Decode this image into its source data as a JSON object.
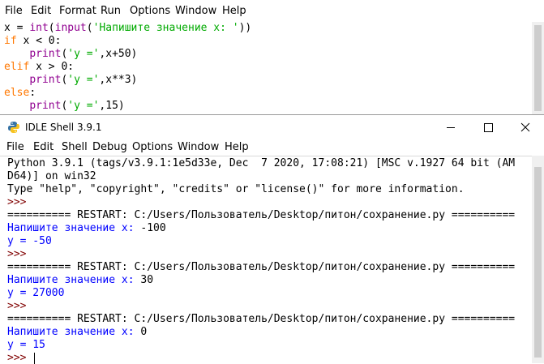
{
  "editor_menu": [
    "File",
    "Edit",
    "Format",
    "Run",
    "Options",
    "Window",
    "Help"
  ],
  "editor_lines": [
    [
      {
        "t": "x = "
      },
      {
        "t": "int",
        "c": "bi"
      },
      {
        "t": "("
      },
      {
        "t": "input",
        "c": "bi"
      },
      {
        "t": "("
      },
      {
        "t": "'Напишите значение x: '",
        "c": "str"
      },
      {
        "t": "))"
      }
    ],
    [
      {
        "t": "if",
        "c": "kw"
      },
      {
        "t": " x < 0:"
      }
    ],
    [
      {
        "t": "    "
      },
      {
        "t": "print",
        "c": "bi"
      },
      {
        "t": "("
      },
      {
        "t": "'y ='",
        "c": "str"
      },
      {
        "t": ",x+50)"
      }
    ],
    [
      {
        "t": "elif",
        "c": "kw"
      },
      {
        "t": " x > 0:"
      }
    ],
    [
      {
        "t": "    "
      },
      {
        "t": "print",
        "c": "bi"
      },
      {
        "t": "("
      },
      {
        "t": "'y ='",
        "c": "str"
      },
      {
        "t": ",x**3)"
      }
    ],
    [
      {
        "t": "else",
        "c": "kw"
      },
      {
        "t": ":"
      }
    ],
    [
      {
        "t": "    "
      },
      {
        "t": "print",
        "c": "bi"
      },
      {
        "t": "("
      },
      {
        "t": "'y ='",
        "c": "str"
      },
      {
        "t": ",15)"
      }
    ]
  ],
  "shell_window": {
    "title": "IDLE Shell 3.9.1"
  },
  "shell_menu": [
    "File",
    "Edit",
    "Shell",
    "Debug",
    "Options",
    "Window",
    "Help"
  ],
  "shell_lines": [
    [
      {
        "t": "Python 3.9.1 (tags/v3.9.1:1e5d33e, Dec  7 2020, 17:08:21) [MSC v.1927 64 bit (AM"
      }
    ],
    [
      {
        "t": "D64)] on win32"
      }
    ],
    [
      {
        "t": "Type \"help\", \"copyright\", \"credits\" or \"license()\" for more information."
      }
    ],
    [
      {
        "t": ">>> ",
        "c": "prompt"
      }
    ],
    [
      {
        "t": "========== RESTART: C:/Users/Пользователь/Desktop/питон/сохранение.py =========="
      }
    ],
    [
      {
        "t": "Напишите значение x: ",
        "c": "blue"
      },
      {
        "t": "-100"
      }
    ],
    [
      {
        "t": "y = -50",
        "c": "blue"
      }
    ],
    [
      {
        "t": ">>> ",
        "c": "prompt"
      }
    ],
    [
      {
        "t": "========== RESTART: C:/Users/Пользователь/Desktop/питон/сохранение.py =========="
      }
    ],
    [
      {
        "t": "Напишите значение x: ",
        "c": "blue"
      },
      {
        "t": "30"
      }
    ],
    [
      {
        "t": "y = 27000",
        "c": "blue"
      }
    ],
    [
      {
        "t": ">>> ",
        "c": "prompt"
      }
    ],
    [
      {
        "t": "========== RESTART: C:/Users/Пользователь/Desktop/питон/сохранение.py =========="
      }
    ],
    [
      {
        "t": "Напишите значение x: ",
        "c": "blue"
      },
      {
        "t": "0"
      }
    ],
    [
      {
        "t": "y = 15",
        "c": "blue"
      }
    ],
    [
      {
        "t": ">>> ",
        "c": "prompt"
      }
    ]
  ]
}
